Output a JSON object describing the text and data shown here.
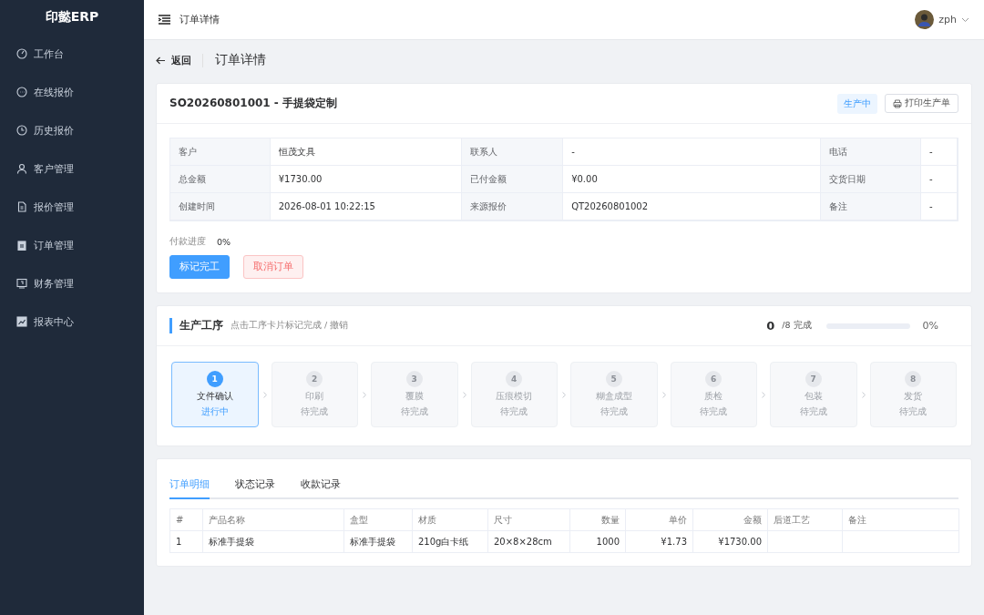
{
  "sidebar": {
    "logo": "印懿ERP",
    "items": [
      {
        "label": "工作台"
      },
      {
        "label": "在线报价"
      },
      {
        "label": "历史报价"
      },
      {
        "label": "客户管理"
      },
      {
        "label": "报价管理"
      },
      {
        "label": "订单管理"
      },
      {
        "label": "财务管理"
      },
      {
        "label": "报表中心"
      }
    ]
  },
  "header": {
    "title": "订单详情",
    "user": "zph"
  },
  "page": {
    "back": "返回",
    "title": "订单详情"
  },
  "order": {
    "title": "SO20260801001 - 手提袋定制",
    "status": "生产中",
    "print_button": "打印生产单",
    "info": [
      [
        {
          "label": "客户",
          "value": "恒茂文具"
        },
        {
          "label": "联系人",
          "value": "-"
        },
        {
          "label": "电话",
          "value": "-"
        }
      ],
      [
        {
          "label": "总金额",
          "value": "¥1730.00"
        },
        {
          "label": "已付金额",
          "value": "¥0.00"
        },
        {
          "label": "交货日期",
          "value": "-"
        }
      ],
      [
        {
          "label": "创建时间",
          "value": "2026-08-01 10:22:15"
        },
        {
          "label": "来源报价",
          "value": "QT20260801002"
        },
        {
          "label": "备注",
          "value": "-"
        }
      ]
    ],
    "payment_label": "付款进度",
    "payment_reading": "0%",
    "buttons": [
      {
        "label": "标记完工",
        "kind": "primary"
      },
      {
        "label": "取消订单",
        "kind": "danger"
      }
    ]
  },
  "production": {
    "title": "生产工序",
    "hint": "点击工序卡片标记完成 / 撤销",
    "done": "0",
    "total": "/8 完成",
    "level": 0,
    "reading": "0%",
    "steps": [
      {
        "number": "1",
        "name": "文件确认",
        "status": "进行中",
        "active": true
      },
      {
        "number": "2",
        "name": "印刷",
        "status": "待完成",
        "active": false
      },
      {
        "number": "3",
        "name": "覆膜",
        "status": "待完成",
        "active": false
      },
      {
        "number": "4",
        "name": "压痕模切",
        "status": "待完成",
        "active": false
      },
      {
        "number": "5",
        "name": "糊盒成型",
        "status": "待完成",
        "active": false
      },
      {
        "number": "6",
        "name": "质检",
        "status": "待完成",
        "active": false
      },
      {
        "number": "7",
        "name": "包装",
        "status": "待完成",
        "active": false
      },
      {
        "number": "8",
        "name": "发货",
        "status": "待完成",
        "active": false
      }
    ]
  },
  "details": {
    "tabs": [
      {
        "label": "订单明细",
        "selected": true
      },
      {
        "label": "状态记录",
        "selected": false
      },
      {
        "label": "收款记录",
        "selected": false
      }
    ],
    "table": {
      "columns": [
        "#",
        "产品名称",
        "盒型",
        "材质",
        "尺寸",
        "数量",
        "单价",
        "金额",
        "后道工艺",
        "备注"
      ],
      "rows": [
        [
          "1",
          "标准手提袋",
          "标准手提袋",
          "210g白卡纸",
          "20×8×28cm",
          "1000",
          "¥1.73",
          "¥1730.00",
          "",
          ""
        ]
      ]
    }
  }
}
